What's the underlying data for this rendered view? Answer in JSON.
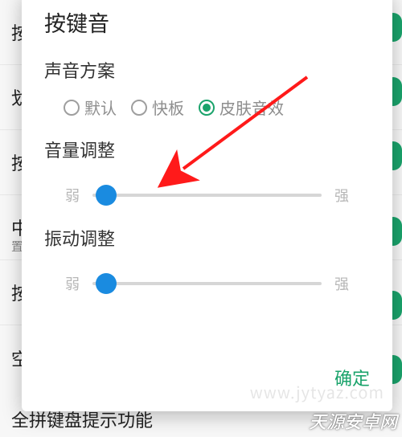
{
  "background": {
    "rows": [
      {
        "label": "按"
      },
      {
        "label": "划"
      },
      {
        "label": "按"
      },
      {
        "label": "中",
        "sub": "置"
      },
      {
        "label": "按"
      },
      {
        "label": "空"
      }
    ],
    "lastRow": "全拼键盘提示功能"
  },
  "dialog": {
    "title": "按键音",
    "soundScheme": {
      "label": "声音方案",
      "options": [
        {
          "label": "默认",
          "selected": false
        },
        {
          "label": "快板",
          "selected": false
        },
        {
          "label": "皮肤音效",
          "selected": true
        }
      ]
    },
    "volume": {
      "label": "音量调整",
      "minLabel": "弱",
      "maxLabel": "强",
      "percent": 6
    },
    "vibration": {
      "label": "振动调整",
      "minLabel": "弱",
      "maxLabel": "强",
      "percent": 6
    },
    "confirm": "确定"
  },
  "watermarks": {
    "bottomRight": "天源安卓网",
    "faint": "www.jytyaz.com"
  }
}
